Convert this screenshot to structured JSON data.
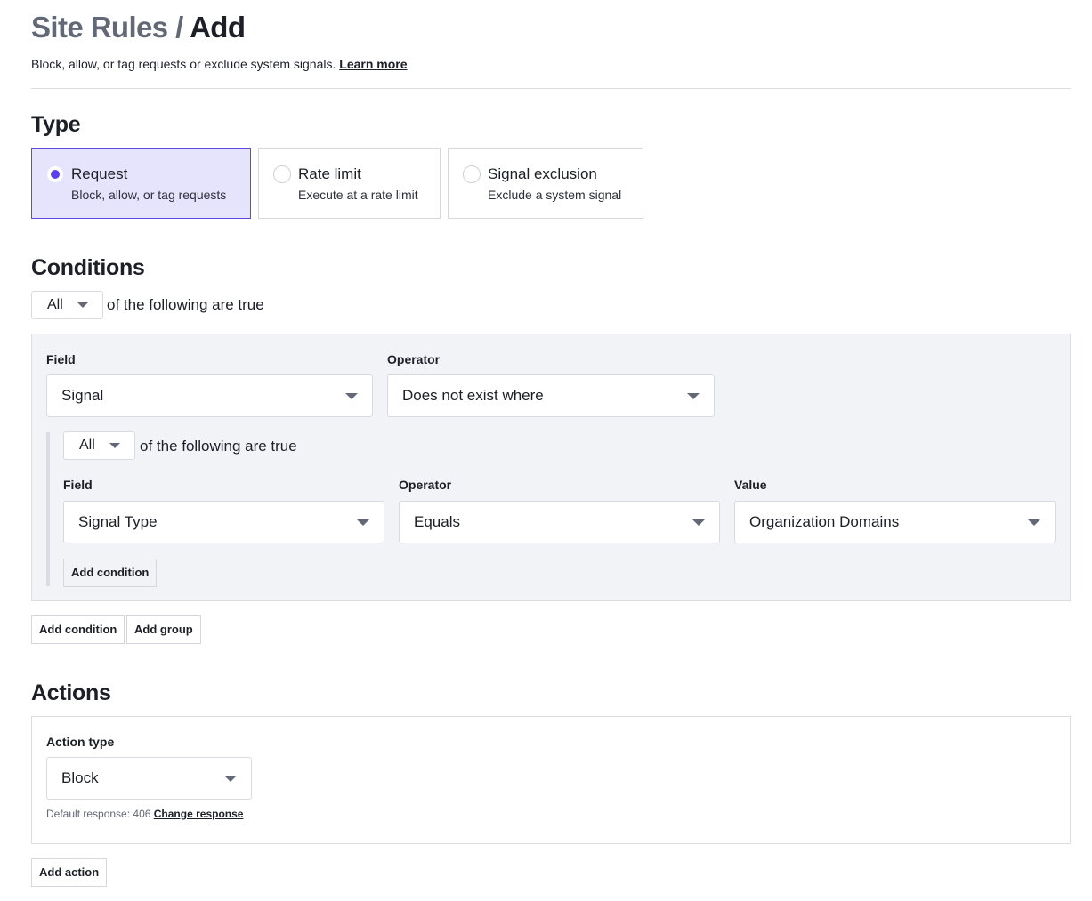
{
  "header": {
    "breadcrumb_parent": "Site Rules",
    "breadcrumb_separator": "/",
    "breadcrumb_current": "Add",
    "subtitle": "Block, allow, or tag requests or exclude system signals.",
    "learn_more_link": "Learn more"
  },
  "type_section": {
    "heading": "Type",
    "options": [
      {
        "label": "Request",
        "description": "Block, allow, or tag requests",
        "selected": true
      },
      {
        "label": "Rate limit",
        "description": "Execute at a rate limit",
        "selected": false
      },
      {
        "label": "Signal exclusion",
        "description": "Exclude a system signal",
        "selected": false
      }
    ]
  },
  "conditions_section": {
    "heading": "Conditions",
    "match_select": "All",
    "match_text": "of the following are true",
    "condition": {
      "field_label": "Field",
      "field_value": "Signal",
      "operator_label": "Operator",
      "operator_value": "Does not exist where",
      "nested_group": {
        "match_select": "All",
        "match_text": "of the following are true",
        "field_label": "Field",
        "field_value": "Signal Type",
        "operator_label": "Operator",
        "operator_value": "Equals",
        "value_label": "Value",
        "value_value": "Organization Domains",
        "add_condition_button": "Add condition"
      }
    },
    "add_condition_button": "Add condition",
    "add_group_button": "Add group"
  },
  "actions_section": {
    "heading": "Actions",
    "action_type_label": "Action type",
    "action_type_value": "Block",
    "default_response_text": "Default response: 406",
    "change_response_link": "Change response",
    "add_action_button": "Add action"
  },
  "colors": {
    "accent": "#5b3ff0",
    "selected_card_bg": "#e6e4fd",
    "group_bg": "#f2f3f7",
    "muted_text": "#626875"
  }
}
